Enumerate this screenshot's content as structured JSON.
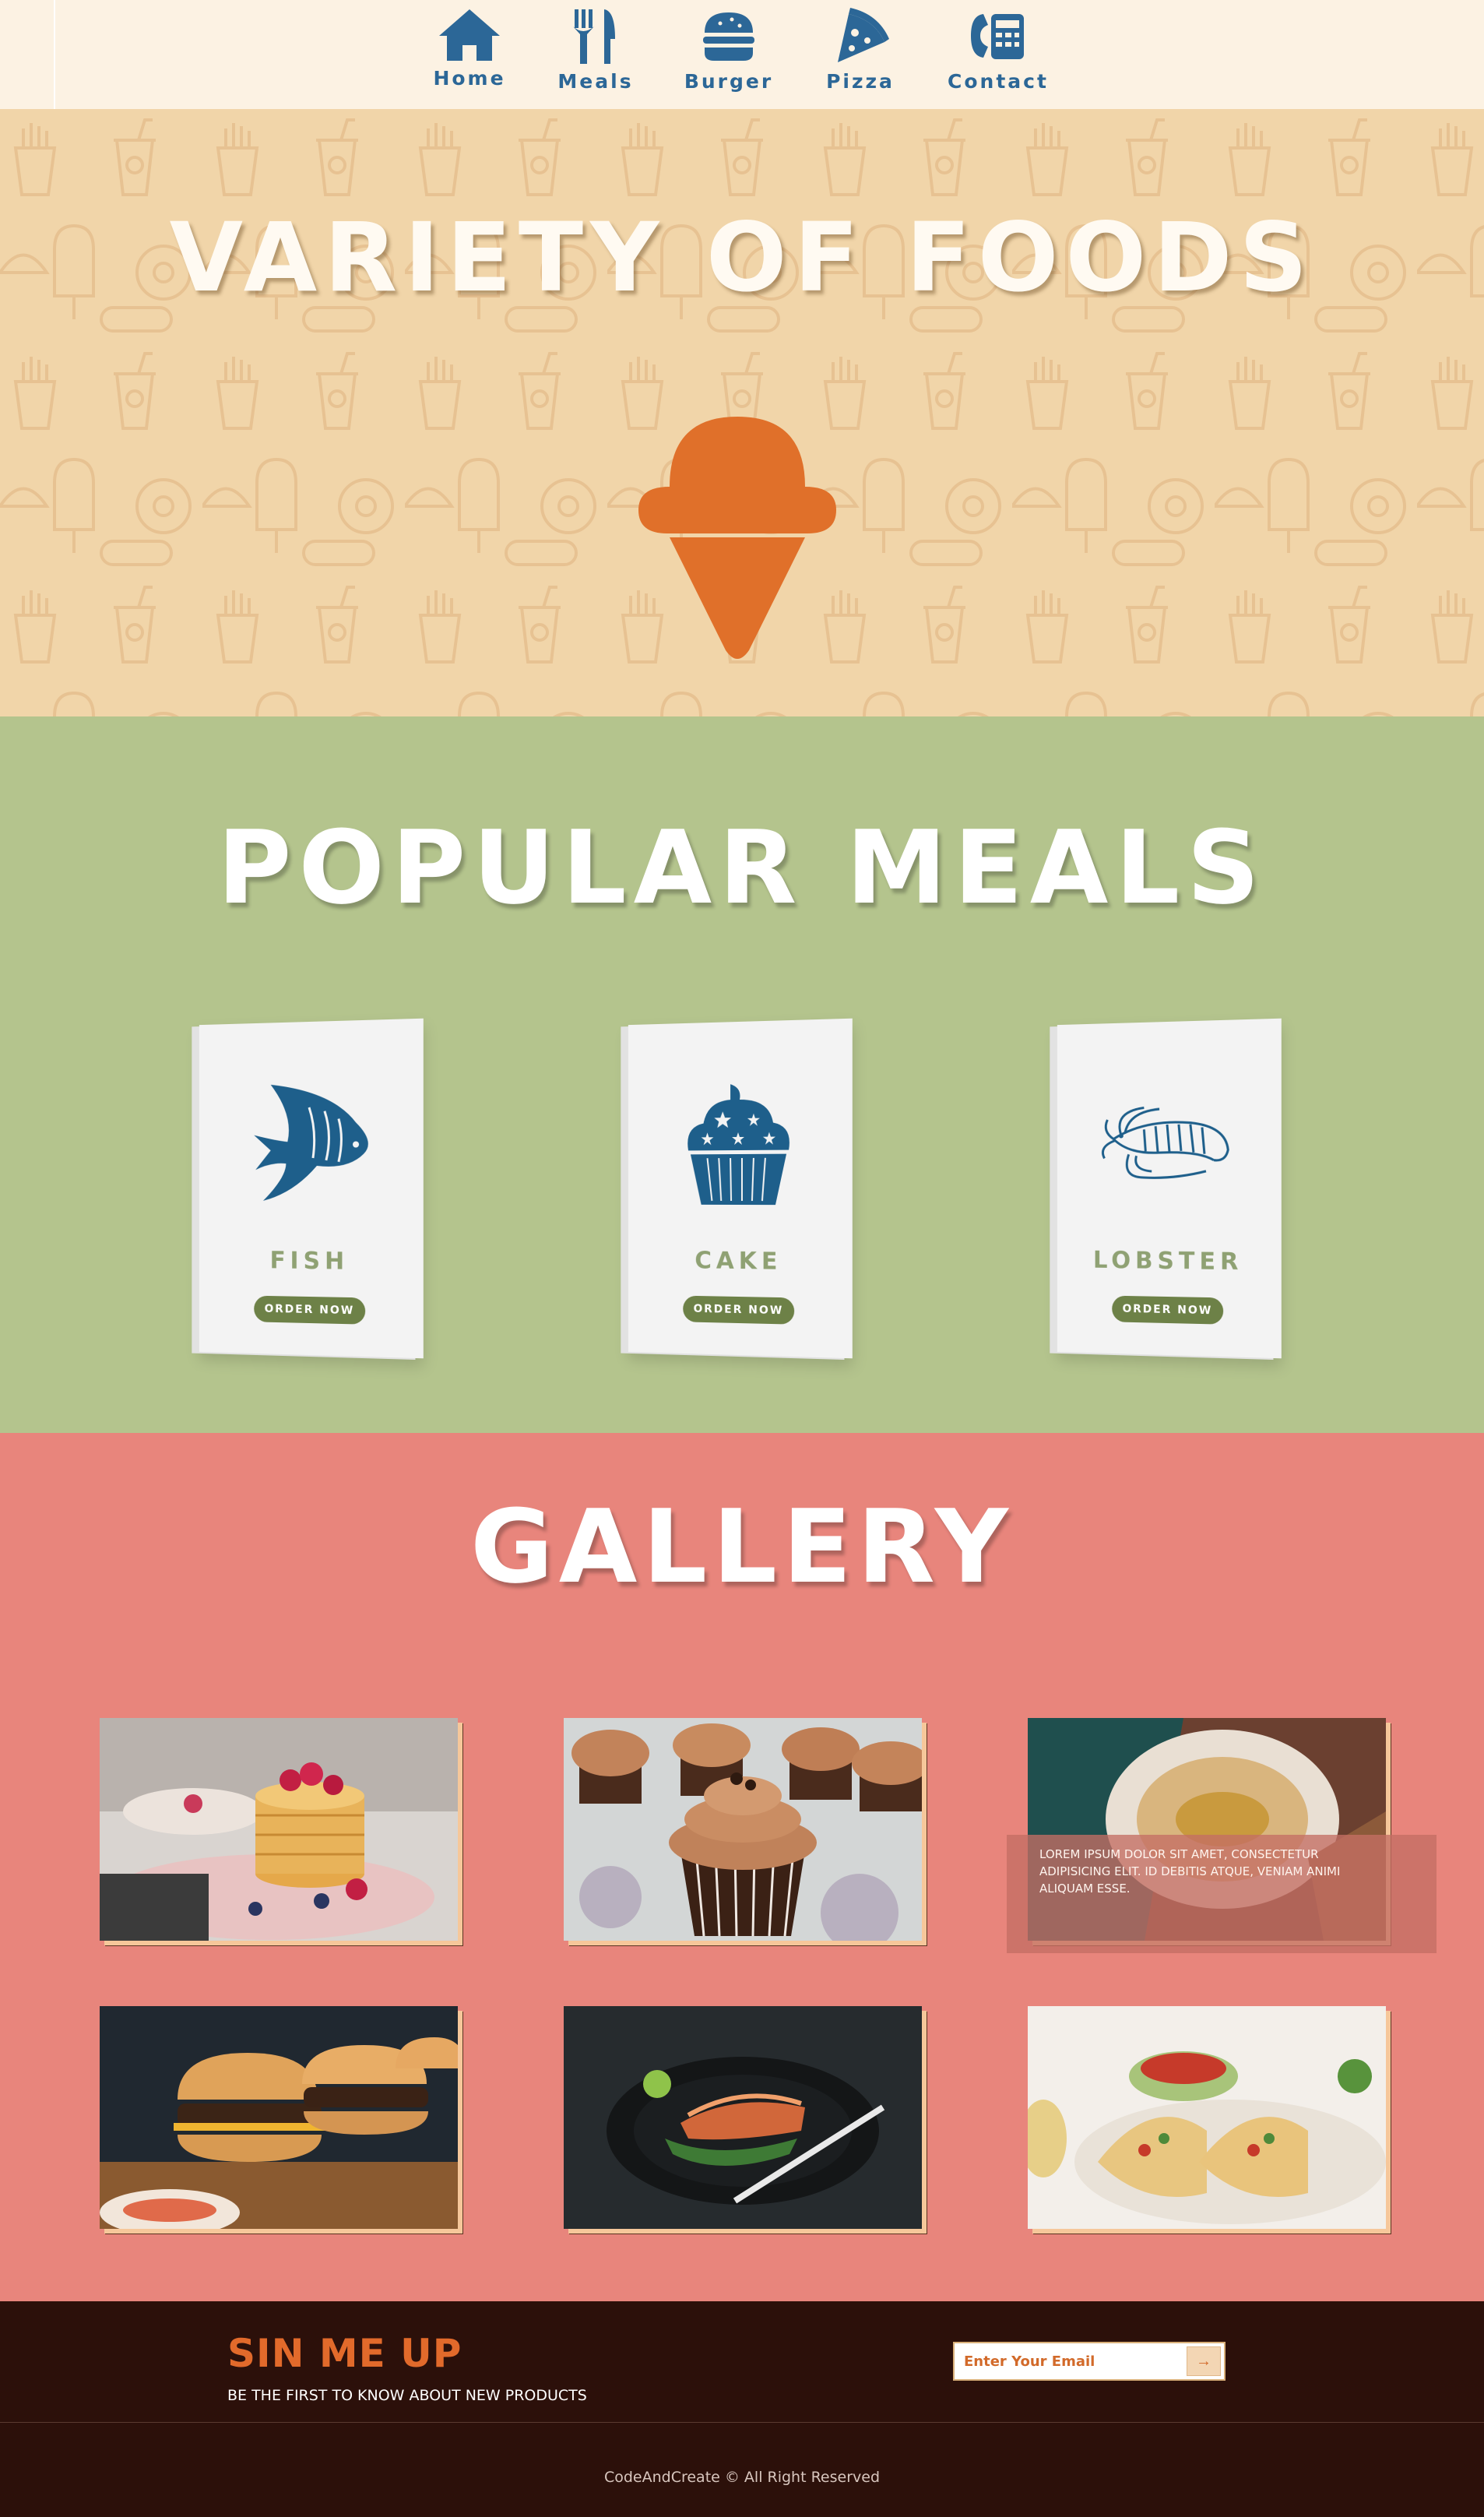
{
  "nav": {
    "items": [
      {
        "label": "Home",
        "icon": "home-icon"
      },
      {
        "label": "Meals",
        "icon": "utensils-icon"
      },
      {
        "label": "Burger",
        "icon": "burger-icon"
      },
      {
        "label": "Pizza",
        "icon": "pizza-icon"
      },
      {
        "label": "Contact",
        "icon": "phone-icon"
      }
    ]
  },
  "hero": {
    "title": "VARIETY OF FOODS",
    "icon": "ice-cream-icon"
  },
  "popular": {
    "title": "POPULAR MEALS",
    "cards": [
      {
        "name": "FISH",
        "button": "ORDER NOW",
        "icon": "fish-icon"
      },
      {
        "name": "CAKE",
        "button": "ORDER NOW",
        "icon": "cupcake-icon"
      },
      {
        "name": "LOBSTER",
        "button": "ORDER NOW",
        "icon": "lobster-icon"
      }
    ]
  },
  "gallery": {
    "title": "GALLERY",
    "overlay_text": "LOREM IPSUM DOLOR SIT AMET, CONSECTETUR ADIPISICING ELIT. ID DEBITIS ATQUE, VENIAM ANIMI ALIQUAM ESSE.",
    "photos": [
      "pancakes",
      "cupcakes",
      "hummus",
      "burgers",
      "salmon",
      "tacos"
    ]
  },
  "footer": {
    "signup_title": "SIN ME UP",
    "signup_subtitle": "BE THE FIRST TO KNOW ABOUT NEW PRODUCTS",
    "email_placeholder": "Enter Your Email",
    "submit_label": "→",
    "copyright": "CodeAndCreate © All Right Reserved"
  },
  "colors": {
    "nav_bg": "#fcf2e3",
    "nav_icon": "#2c6797",
    "hero_bg": "#f1d5a9",
    "accent_orange": "#e0702a",
    "popular_bg": "#b4c48d",
    "button_green": "#6d8147",
    "gallery_bg": "#e8857c",
    "footer_bg": "#2c100a"
  }
}
